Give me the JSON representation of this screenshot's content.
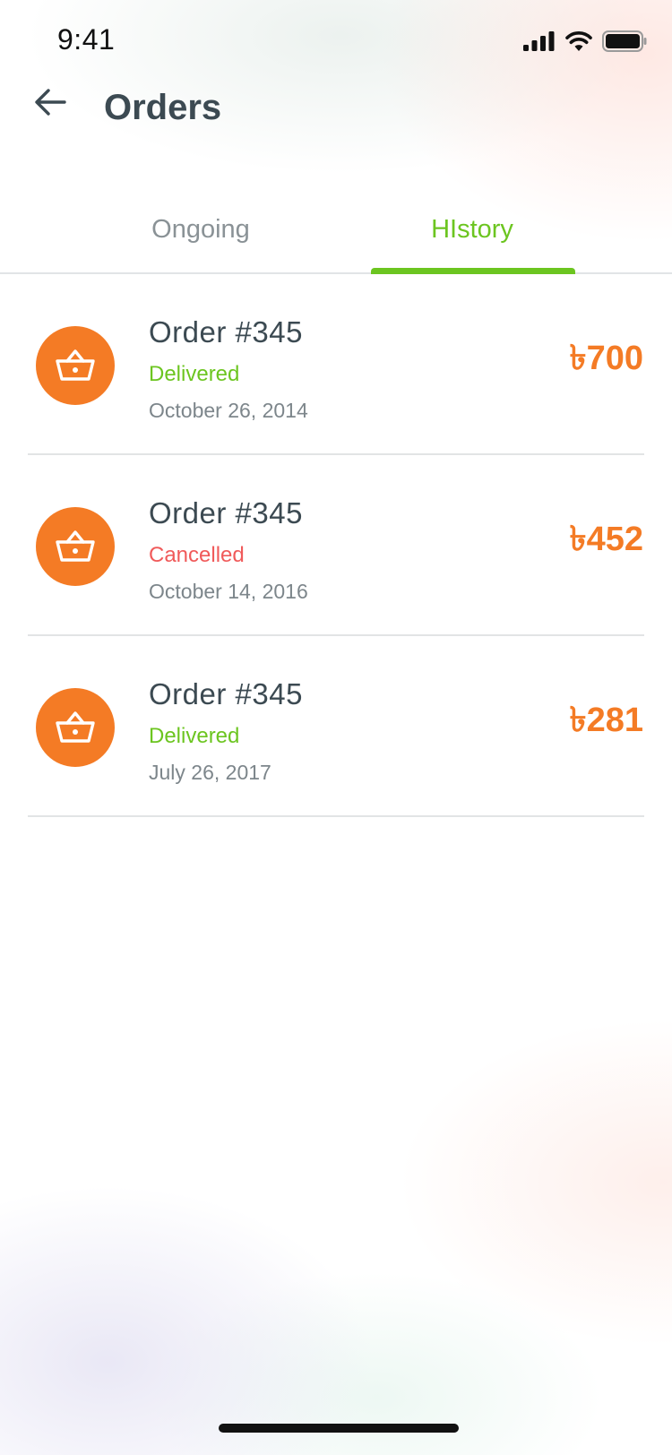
{
  "status_bar": {
    "time": "9:41"
  },
  "header": {
    "title": "Orders"
  },
  "tabs": [
    {
      "label": "Ongoing",
      "active": false
    },
    {
      "label": "HIstory",
      "active": true
    }
  ],
  "colors": {
    "accent_green": "#6cc520",
    "accent_orange": "#f47b25",
    "cancel_red": "#f05a5a",
    "text_dark": "#3c4a52"
  },
  "orders": [
    {
      "title": "Order #345",
      "status": "Delivered",
      "date": "October 26, 2014",
      "amount": "৳700",
      "icon": "basket-icon"
    },
    {
      "title": "Order #345",
      "status": "Cancelled",
      "date": "October 14, 2016",
      "amount": "৳452",
      "icon": "basket-icon"
    },
    {
      "title": "Order #345",
      "status": "Delivered",
      "date": "July 26, 2017",
      "amount": "৳281",
      "icon": "basket-icon"
    }
  ]
}
